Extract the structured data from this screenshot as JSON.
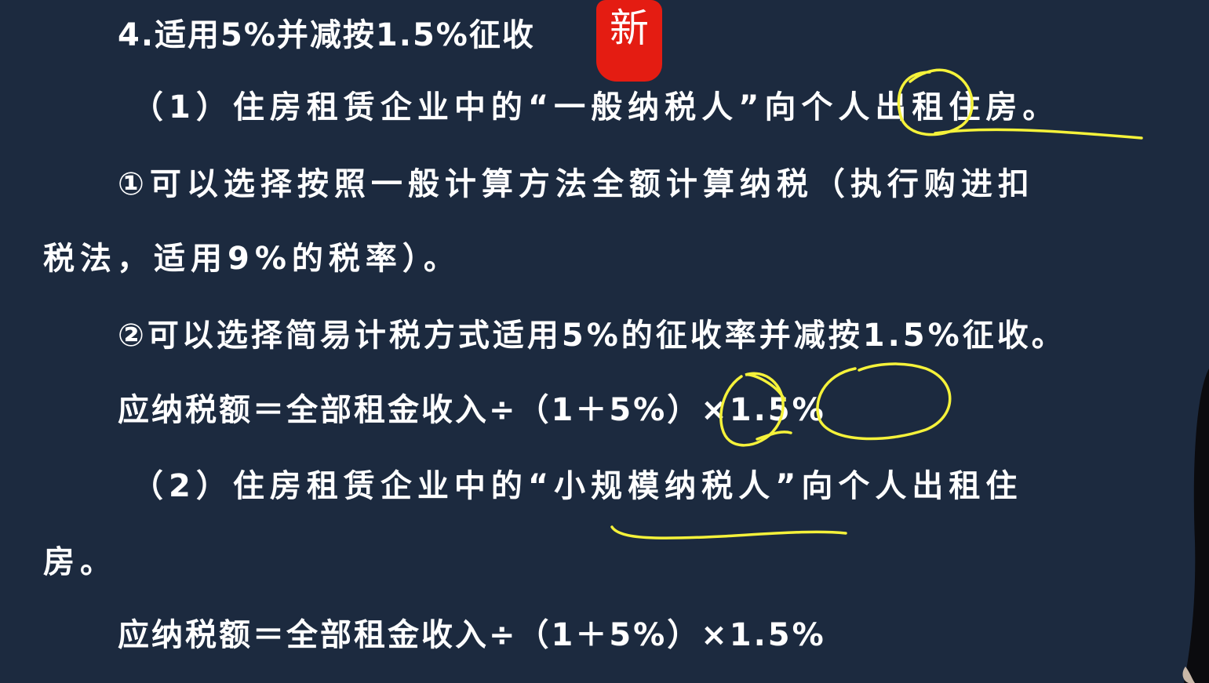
{
  "slide": {
    "heading": "4.适用5%并减按1.5%征收",
    "stamp_char": "新",
    "lines": [
      "（1）住房租赁企业中的“一般纳税人”向个人出租住房。",
      "①可以选择按照一般计算方法全额计算纳税（执行购进扣",
      "税法，适用9%的税率）。",
      "②可以选择简易计税方式适用5%的征收率并减按1.5%征收。",
      "应纳税额＝全部租金收入÷（1＋5%）×1.5%",
      "（2）住房租赁企业中的“小规模纳税人”向个人出租住",
      "房。",
      "应纳税额＝全部租金收入÷（1＋5%）×1.5%"
    ]
  },
  "colors": {
    "background": "#1c2a3f",
    "text": "#ffffff",
    "stamp": "#e41c12",
    "annotation": "#f5f23a"
  }
}
